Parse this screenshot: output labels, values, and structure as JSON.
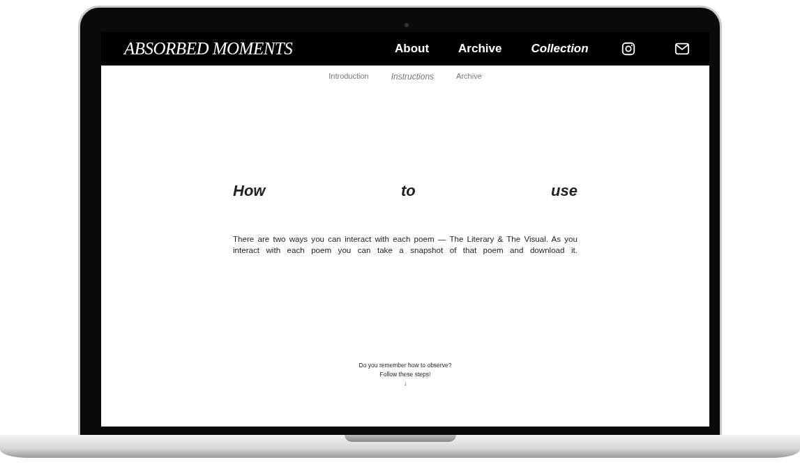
{
  "site": {
    "logo": "ABSORBED MOMENTS",
    "nav": [
      {
        "label": "About",
        "selected": false
      },
      {
        "label": "Archive",
        "selected": false
      },
      {
        "label": "Collection",
        "selected": true
      }
    ],
    "subnav": [
      {
        "label": "Introduction",
        "selected": false
      },
      {
        "label": "Instructions",
        "selected": true
      },
      {
        "label": "Archive",
        "selected": false
      }
    ],
    "heading": "How to use",
    "paragraph": "There are two ways you can interact with each poem — The Literary & The Visual. As you interact with each poem you can take a snapshot of that poem and download it.",
    "prompt": [
      "Do you remember how to observe?",
      "Follow these steps!"
    ],
    "arrow": "↓"
  }
}
